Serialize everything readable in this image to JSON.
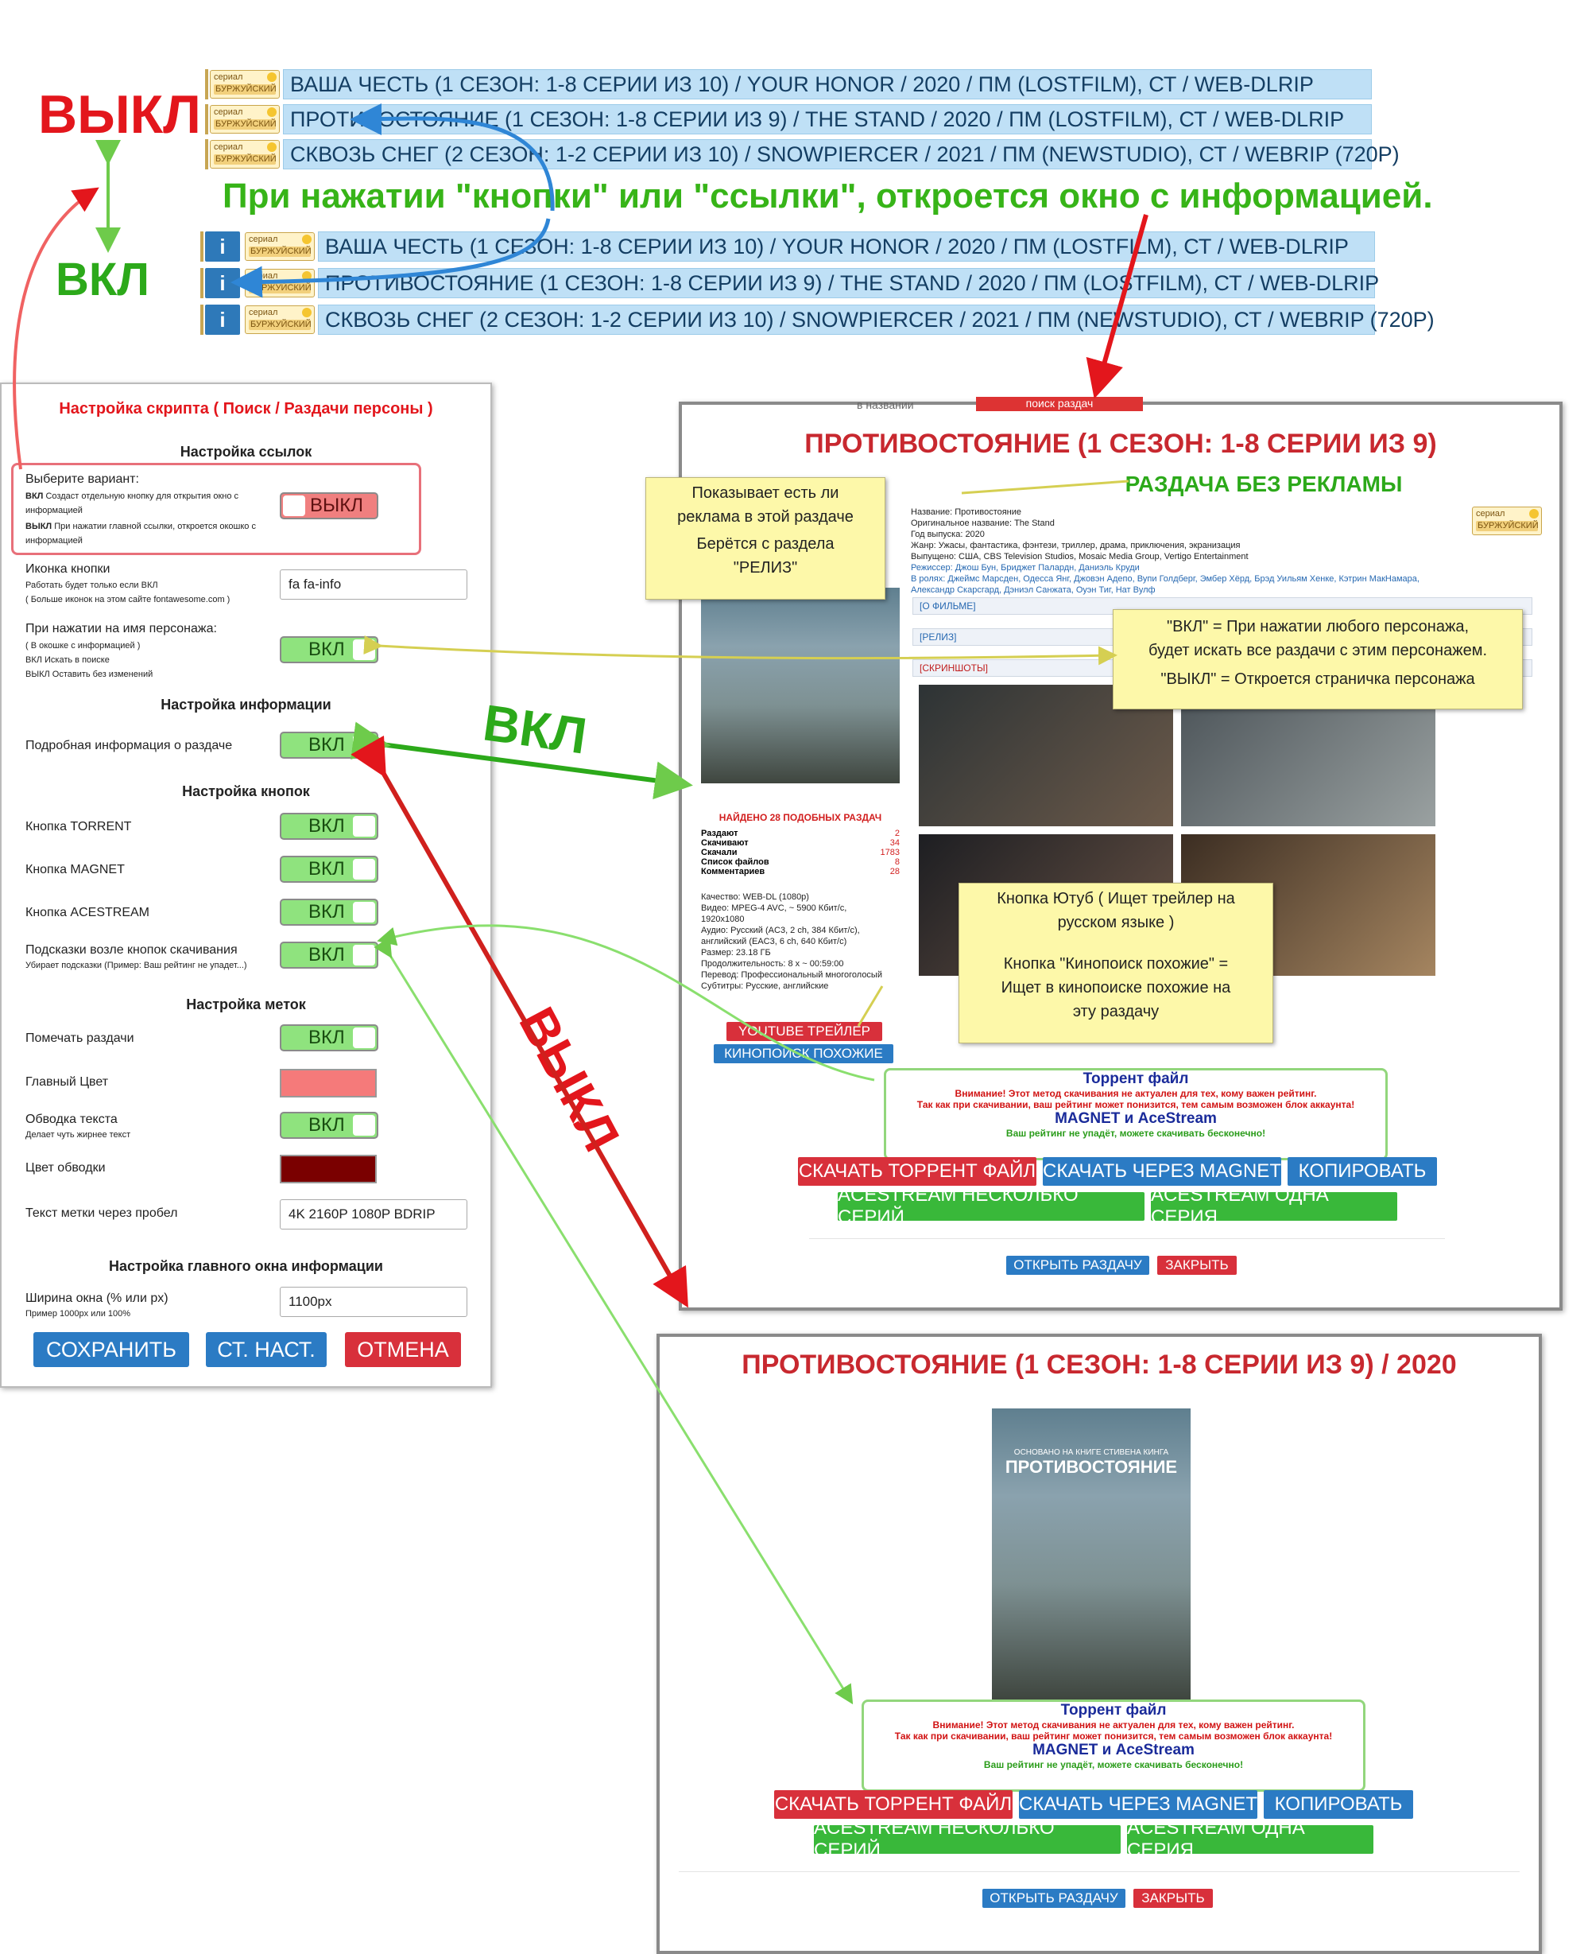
{
  "labels": {
    "off": "ВЫКЛ",
    "on": "ВКЛ",
    "on_small": "ВКЛ",
    "off_big": "ВЫКЛ",
    "on_arrow": "ВКЛ"
  },
  "note_top": "При нажатии \"кнопки\" или \"ссылки\", откроется окно с информацией.",
  "tag": {
    "top": "сериал",
    "bottom": "БУРЖУЙСКИЙ"
  },
  "info_icon": "i",
  "releases_off": [
    "ВАША ЧЕСТЬ (1 СЕЗОН: 1-8 СЕРИИ ИЗ 10) / YOUR HONOR / 2020 / ПМ (LOSTFILM), СТ / WEB-DLRIP",
    "ПРОТИВОСТОЯНИЕ (1 СЕЗОН: 1-8 СЕРИИ ИЗ 9) / THE STAND / 2020 / ПМ (LOSTFILM), СТ / WEB-DLRIP",
    "СКВОЗЬ СНЕГ (2 СЕЗОН: 1-2 СЕРИИ ИЗ 10) / SNOWPIERCER / 2021 / ПМ (NEWSTUDIO), СТ / WEBRIP (720P)"
  ],
  "releases_on": [
    "ВАША ЧЕСТЬ (1 СЕЗОН: 1-8 СЕРИИ ИЗ 10) / YOUR HONOR / 2020 / ПМ (LOSTFILM), СТ / WEB-DLRIP",
    "ПРОТИВОСТОЯНИЕ (1 СЕЗОН: 1-8 СЕРИИ ИЗ 9) / THE STAND / 2020 / ПМ (LOSTFILM), СТ / WEB-DLRIP",
    "СКВОЗЬ СНЕГ (2 СЕЗОН: 1-2 СЕРИИ ИЗ 10) / SNOWPIERCER / 2021 / ПМ (NEWSTUDIO), СТ / WEBRIP (720P)"
  ],
  "settings": {
    "title": "Настройка скрипта ( Поиск / Раздачи персоны )",
    "sec_links": "Настройка ссылок",
    "choose": "Выберите вариант:",
    "choose_on": "Создаст отдельную кнопку для открытия окно с информацией",
    "choose_off": "При нажатии главной ссылки, откроется окошко с информацией",
    "choose_on_key": "ВКЛ",
    "choose_off_key": "ВЫКЛ",
    "icon_label": "Иконка кнопки",
    "icon_hint1": "Работать будет только если ВКЛ",
    "icon_hint2": "( Больше иконок на этом сайте fontawesome.com )",
    "icon_value": "fa fa-info",
    "person_label": "При нажатии на имя персонажа:",
    "person_hint1": "( В окошке с информацией )",
    "person_hint2": "ВКЛ Искать в поиске",
    "person_hint3": "ВЫКЛ Оставить без изменений",
    "sec_info": "Настройка информации",
    "info_label": "Подробная информация о раздаче",
    "sec_buttons": "Настройка кнопок",
    "btn_torrent": "Кнопка TORRENT",
    "btn_magnet": "Кнопка MAGNET",
    "btn_ace": "Кнопка ACESTREAM",
    "btn_hints": "Подсказки возле кнопок скачивания",
    "btn_hints_sub": "Убирает подсказки (Пример: Ваш рейтинг не упадет...)",
    "sec_marks": "Настройка меток",
    "mark_label": "Помечать раздачи",
    "main_color": "Главный Цвет",
    "main_color_value": "#f57a7a",
    "outline_label": "Обводка текста",
    "outline_sub": "Делает чуть жирнее текст",
    "outline_color": "Цвет обводки",
    "outline_color_value": "#7a0000",
    "mark_text_label": "Текст метки через пробел",
    "mark_text_value": "4K 2160P 1080P BDRIP",
    "sec_window": "Настройка главного окна информации",
    "width_label": "Ширина окна (% или px)",
    "width_hint": "Пример 1000px или 100%",
    "width_value": "1100px",
    "save": "СОХРАНИТЬ",
    "defaults": "СТ. НАСТ.",
    "cancel": "ОТМЕНА"
  },
  "win1": {
    "behind1": "в названии",
    "behind2": "поиск раздач",
    "title": "ПРОТИВОСТОЯНИЕ (1 СЕЗОН: 1-8 СЕРИИ ИЗ 9)",
    "no_ads": "РАЗДАЧА БЕЗ РЕКЛАМЫ",
    "lines": [
      "Название: Противостояние",
      "Оригинальное название: The Stand",
      "Год выпуска: 2020",
      "Жанр: Ужасы, фантастика, фэнтези, триллер, драма, приключения, экранизация",
      "Выпущено: США, CBS Television Studios, Mosaic Media Group, Vertigo Entertainment",
      "Режиссер: Джош Бун, Бриджет Палардн, Даниэль Круди",
      "В ролях: Джеймс Марсден, Одесса Янг, Джовэн Адепо, Вупи Голдберг, Эмбер Хёрд, Брэд Уильям Хенке, Кэтрин МакНамара, Александр Скарсгард, Дэниэл Санжата, Оуэн Тиг, Нат Вулф"
    ],
    "about": "[О ФИЛЬМЕ]",
    "release": "[РЕЛИЗ]",
    "screens": "[СКРИНШОТЫ]",
    "found": "НАЙДЕНО 28 ПОДОБНЫХ РАЗДАЧ",
    "stats": [
      {
        "k": "Раздают",
        "v": "2"
      },
      {
        "k": "Скачивают",
        "v": "34"
      },
      {
        "k": "Скачали",
        "v": "1783"
      },
      {
        "k": "Список файлов",
        "v": "8"
      },
      {
        "k": "Комментариев",
        "v": "28"
      }
    ],
    "tech": [
      "Качество: WEB-DL (1080p)",
      "Видео: MPEG-4 AVC, ~ 5900 Кбит/с, 1920x1080",
      "Аудио: Русский (AC3, 2 ch, 384 Кбит/с), английский (EAC3, 6 ch, 640 Кбит/с)",
      "Размер: 23.18 ГБ",
      "Продолжительность: 8 x ~ 00:59:00",
      "Перевод: Профессиональный многоголосый",
      "Субтитры: Русские, английские"
    ],
    "youtube": "YOUTUBE ТРЕЙЛЕР",
    "kp": "КИНОПОИСК ПОХОЖИЕ",
    "open": "ОТКРЫТЬ РАЗДАЧУ",
    "close": "ЗАКРЫТЬ"
  },
  "notes": {
    "ads1": "Показывает есть ли",
    "ads2": "реклама в этой раздаче",
    "ads3": "Берётся с раздела",
    "ads4": "\"РЕЛИЗ\"",
    "person1": "\"ВКЛ\" = При нажатии любого персонажа,",
    "person2": "будет искать все раздачи с этим персонажем.",
    "person3": "\"ВЫКЛ\" = Откроется страничка персонажа",
    "yt1": "Кнопка Ютуб ( Ищет трейлер на",
    "yt2": "русском языке )",
    "yt3": "Кнопка \"Кинопоиск похожие\" =",
    "yt4": "Ищет в кинопоиске похожие на",
    "yt5": "эту раздачу"
  },
  "torrent": {
    "title": "Торрент файл",
    "warn1": "Внимание! Этот метод скачивания не актуален для тех, кому важен рейтинг.",
    "warn2": "Так как при скачивании, ваш рейтинг может понизится, тем самым возможен блок аккаунта!",
    "magnet": "MAGNET и AceStream",
    "ok": "Ваш рейтинг не упадёт, можете скачивать бесконечно!",
    "dl_torrent": "СКАЧАТЬ ТОРРЕНТ ФАЙЛ",
    "dl_magnet": "СКАЧАТЬ ЧЕРЕЗ MAGNET",
    "copy": "КОПИРОВАТЬ",
    "ace_many": "ACESTREAM НЕСКОЛЬКО СЕРИЙ",
    "ace_one": "ACESTREAM ОДНА СЕРИЯ"
  },
  "win2": {
    "title": "ПРОТИВОСТОЯНИЕ (1 СЕЗОН: 1-8 СЕРИИ ИЗ 9) / 2020",
    "poster_top": "ОСНОВАНО НА КНИГЕ СТИВЕНА КИНГА",
    "poster_title": "ПРОТИВОСТОЯНИЕ",
    "open": "ОТКРЫТЬ РАЗДАЧУ",
    "close": "ЗАКРЫТЬ"
  },
  "colors": {
    "red": "#e3161c",
    "green": "#2ca91a",
    "blue_btn": "#2b7bc4",
    "red_btn": "#d8303b",
    "green_btn": "#39b83a"
  }
}
